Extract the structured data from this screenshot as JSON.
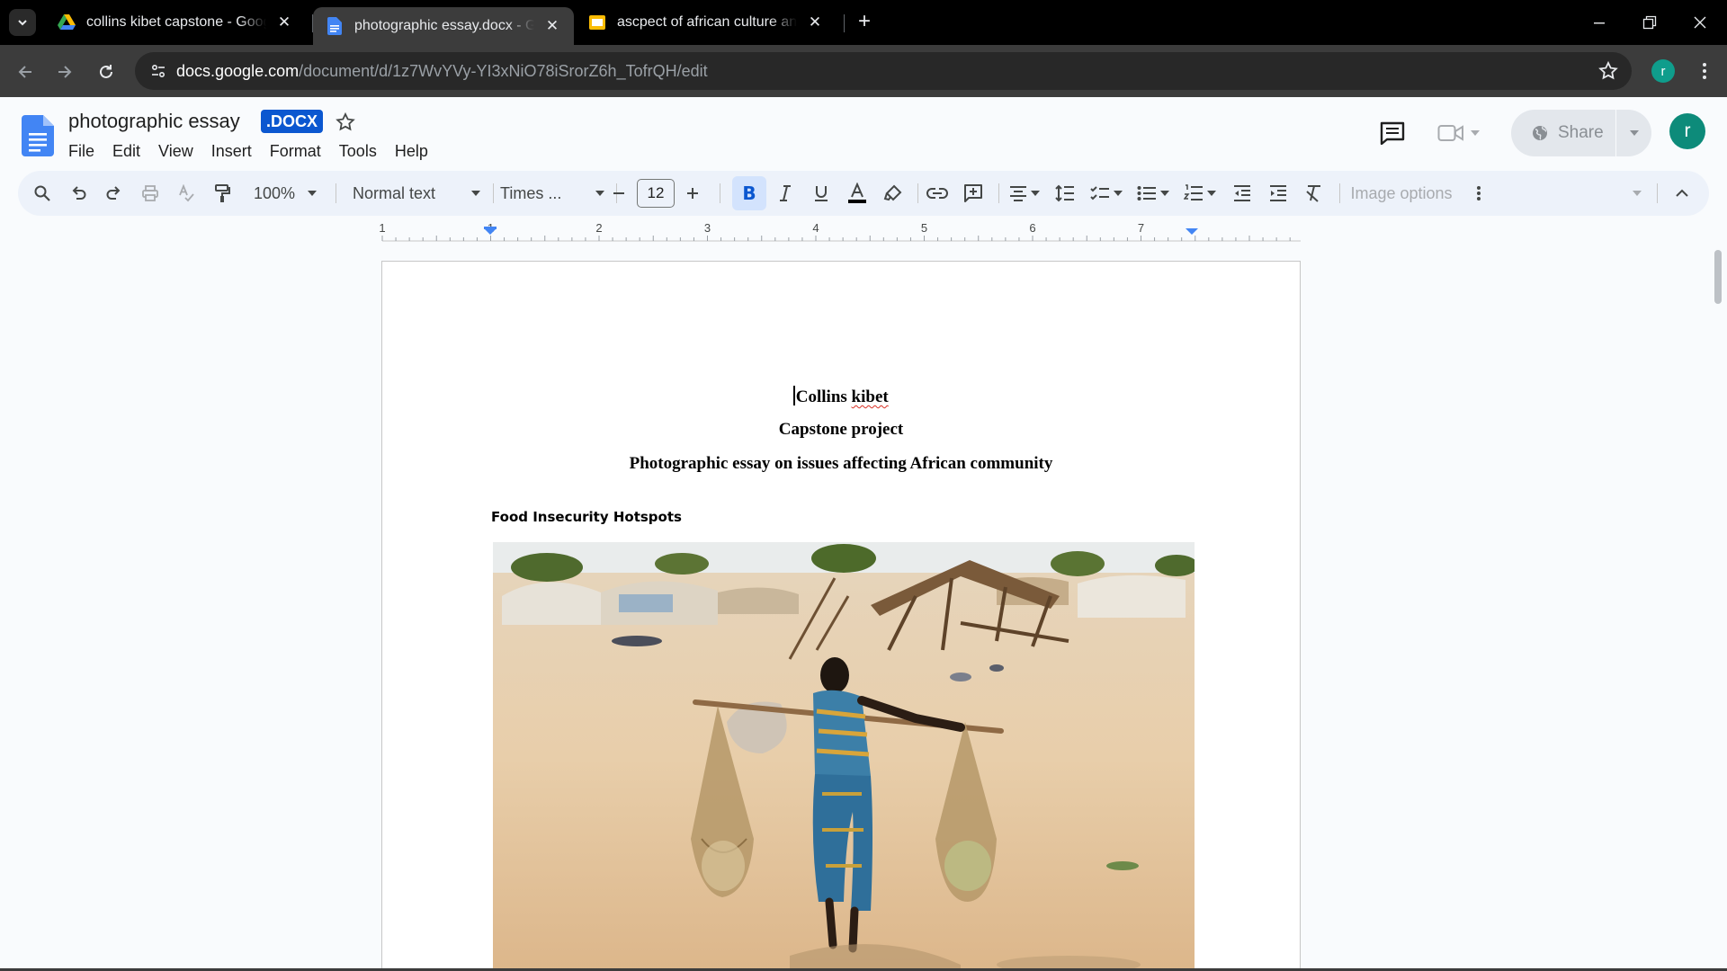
{
  "browser": {
    "tabs": [
      {
        "title": "collins kibet capstone - Google",
        "icon": "google-drive-icon",
        "active": false
      },
      {
        "title": "photographic essay.docx - Goo",
        "icon": "google-docs-icon",
        "active": true
      },
      {
        "title": "ascpect of african culture and B",
        "icon": "google-slides-icon",
        "active": false
      }
    ],
    "url_host": "docs.google.com",
    "url_path": "/document/d/1z7WvYVy-YI3xNiO78iSrorZ6h_TofrQH/edit",
    "profile_initial": "r"
  },
  "docs": {
    "title": "photographic essay",
    "badge": ".DOCX",
    "menu": [
      "File",
      "Edit",
      "View",
      "Insert",
      "Format",
      "Tools",
      "Help"
    ],
    "share_label": "Share",
    "avatar_initial": "r"
  },
  "toolbar": {
    "zoom": "100%",
    "style": "Normal text",
    "font": "Times ...",
    "font_size": "12",
    "bold_label": "B",
    "image_options": "Image options"
  },
  "ruler": {
    "numbers": [
      "1",
      "1",
      "2",
      "3",
      "4",
      "5",
      "6",
      "7"
    ]
  },
  "document": {
    "author_first": "Collins",
    "author_last": "kibet",
    "subtitle": "Capstone project",
    "heading": "Photographic essay on issues affecting African community",
    "section_heading": "Food Insecurity Hotspots"
  },
  "colors": {
    "accent": "#0b57d0",
    "toolbar_bg": "#edf2fa",
    "spell_underline": "#d93025"
  }
}
